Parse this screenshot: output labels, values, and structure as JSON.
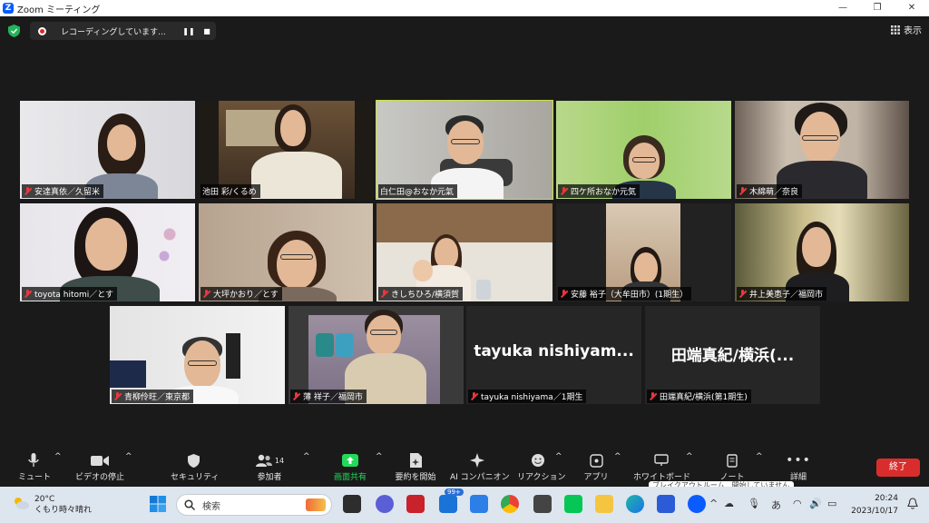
{
  "window": {
    "title": "Zoom ミーティング",
    "logo": "Z",
    "controls": [
      "—",
      "❐",
      "✕"
    ]
  },
  "recording": {
    "label": "レコーディングしています...",
    "pause": "❚❚",
    "stop": "■"
  },
  "view_button": {
    "label": "表示"
  },
  "participants": [
    {
      "name": "安達真依／久留米"
    },
    {
      "name": "池田 彩/くるめ"
    },
    {
      "name": "白仁田@おなか元氣"
    },
    {
      "name": "四ケ所おなか元気"
    },
    {
      "name": "木綿萌／奈良"
    },
    {
      "name": "toyota hitomi／とす"
    },
    {
      "name": "大坪かおり／とす"
    },
    {
      "name": "きしちひろ/横須賀"
    },
    {
      "name": "安藤 裕子（大牟田市）(1期生）"
    },
    {
      "name": "井上美恵子／福岡市"
    },
    {
      "name": "青柳伶旺／東京都"
    },
    {
      "name": "薄 祥子／福岡市"
    },
    {
      "name": "tayuka nishiyama／1期生",
      "display": "tayuka  nishiyam..."
    },
    {
      "name": "田端真紀/横浜(第1期生)",
      "display": "田端真紀/横浜(..."
    }
  ],
  "toolbar": {
    "mute": "ミュート",
    "video": "ビデオの停止",
    "security": "セキュリティ",
    "participants": "参加者",
    "participants_count": "14",
    "share": "画面共有",
    "summary": "要約を開始",
    "ai": "AI コンパニオン",
    "reactions": "リアクション",
    "apps": "アプリ",
    "whiteboard": "ホワイトボード",
    "notes": "ノート",
    "more": "詳細",
    "end": "終了",
    "share_color": "#23d959"
  },
  "toast": {
    "text": "ブレイクアウトルーム　開始していません"
  },
  "taskbar": {
    "weather_temp": "20°C",
    "weather_desc": "くもり時々晴れ",
    "search_placeholder": "検索",
    "mail_badge": "99+",
    "ime": "あ",
    "time": "20:24",
    "date": "2023/10/17"
  }
}
